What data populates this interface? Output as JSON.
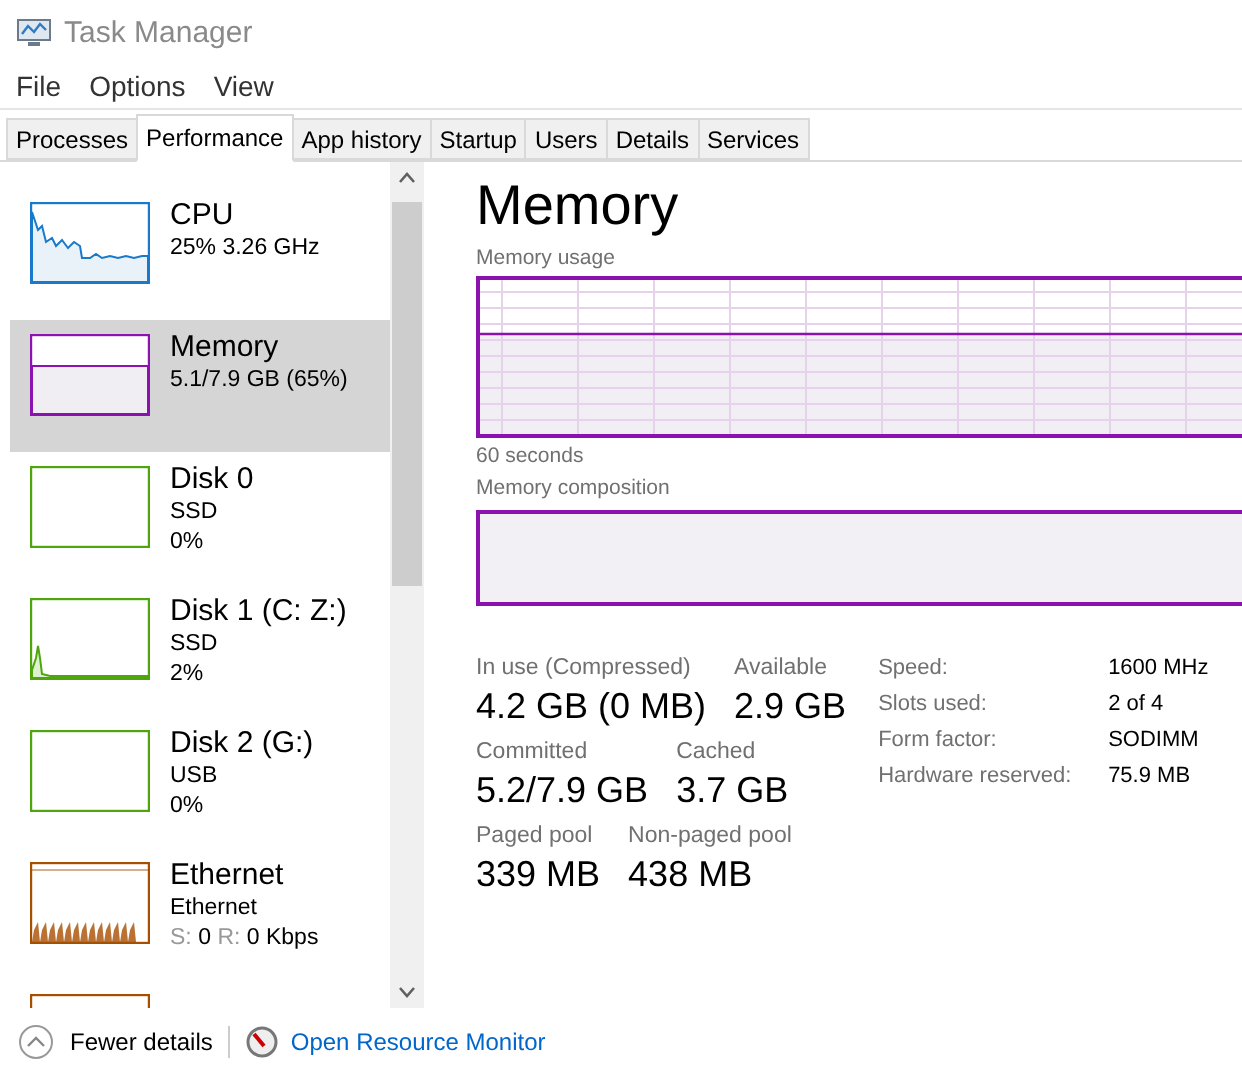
{
  "window": {
    "title": "Task Manager"
  },
  "menu": [
    "File",
    "Options",
    "View"
  ],
  "tabs": [
    {
      "label": "Processes",
      "selected": false
    },
    {
      "label": "Performance",
      "selected": true
    },
    {
      "label": "App history",
      "selected": false
    },
    {
      "label": "Startup",
      "selected": false
    },
    {
      "label": "Users",
      "selected": false
    },
    {
      "label": "Details",
      "selected": false
    },
    {
      "label": "Services",
      "selected": false
    }
  ],
  "sidebar": {
    "items": [
      {
        "kind": "cpu",
        "name": "CPU",
        "color": "#1979ca",
        "lines": [
          "25% 3.26 GHz"
        ],
        "selected": false
      },
      {
        "kind": "memory",
        "name": "Memory",
        "color": "#8b12ae",
        "lines": [
          "5.1/7.9 GB (65%)"
        ],
        "selected": true
      },
      {
        "kind": "disk_idle",
        "name": "Disk 0",
        "color": "#4da60c",
        "lines": [
          "SSD",
          "0%"
        ],
        "selected": false
      },
      {
        "kind": "disk_spike",
        "name": "Disk 1 (C: Z:)",
        "color": "#4da60c",
        "lines": [
          "SSD",
          "2%"
        ],
        "selected": false
      },
      {
        "kind": "disk_idle",
        "name": "Disk 2 (G:)",
        "color": "#4da60c",
        "lines": [
          "USB",
          "0%"
        ],
        "selected": false
      },
      {
        "kind": "network",
        "name": "Ethernet",
        "color": "#a74f01",
        "lines": [
          "Ethernet"
        ],
        "throughput": {
          "s_label": "S:",
          "s_value": "0",
          "r_label": "R:",
          "r_value": "0 Kbps"
        },
        "selected": false
      }
    ]
  },
  "detail": {
    "title": "Memory",
    "usage_label": "Memory usage",
    "time_label": "60 seconds",
    "composition_label": "Memory composition",
    "stat_rows": [
      [
        {
          "label": "In use (Compressed)",
          "value": "4.2 GB (0 MB)"
        },
        {
          "label": "Available",
          "value": "2.9 GB"
        }
      ],
      [
        {
          "label": "Committed",
          "value": "5.2/7.9 GB"
        },
        {
          "label": "Cached",
          "value": "3.7 GB"
        }
      ],
      [
        {
          "label": "Paged pool",
          "value": "339 MB"
        },
        {
          "label": "Non-paged pool",
          "value": "438 MB"
        }
      ]
    ],
    "properties": [
      {
        "label": "Speed:",
        "value": "1600 MHz"
      },
      {
        "label": "Slots used:",
        "value": "2 of 4"
      },
      {
        "label": "Form factor:",
        "value": "SODIMM"
      },
      {
        "label": "Hardware reserved:",
        "value": "75.9 MB"
      }
    ]
  },
  "footer": {
    "fewer_details": "Fewer details",
    "resource_monitor": "Open Resource Monitor"
  }
}
